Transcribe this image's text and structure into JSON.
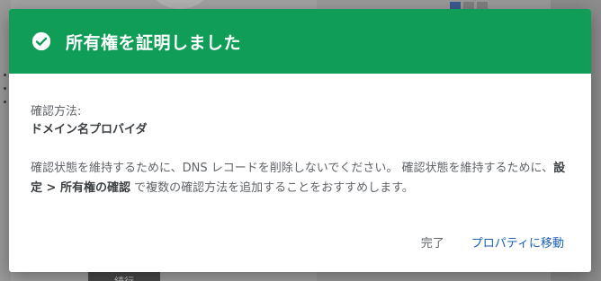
{
  "background": {
    "button_label": "続行"
  },
  "dialog": {
    "title": "所有権を証明しました",
    "icon": "check-circle-icon",
    "header_color": "#0f9d58",
    "method_label": "確認方法:",
    "method_value": "ドメイン名プロバイダ",
    "info_text_1": "確認状態を維持するために、DNS レコードを削除しないでください。 確認状態を維持するために、",
    "info_bold": "設定 > 所有権の確認",
    "info_text_2": " で複数の確認方法を追加することをおすすめします。",
    "buttons": {
      "done": "完了",
      "go_to_property": "プロパティに移動"
    },
    "accent_color": "#1a5fb4"
  }
}
